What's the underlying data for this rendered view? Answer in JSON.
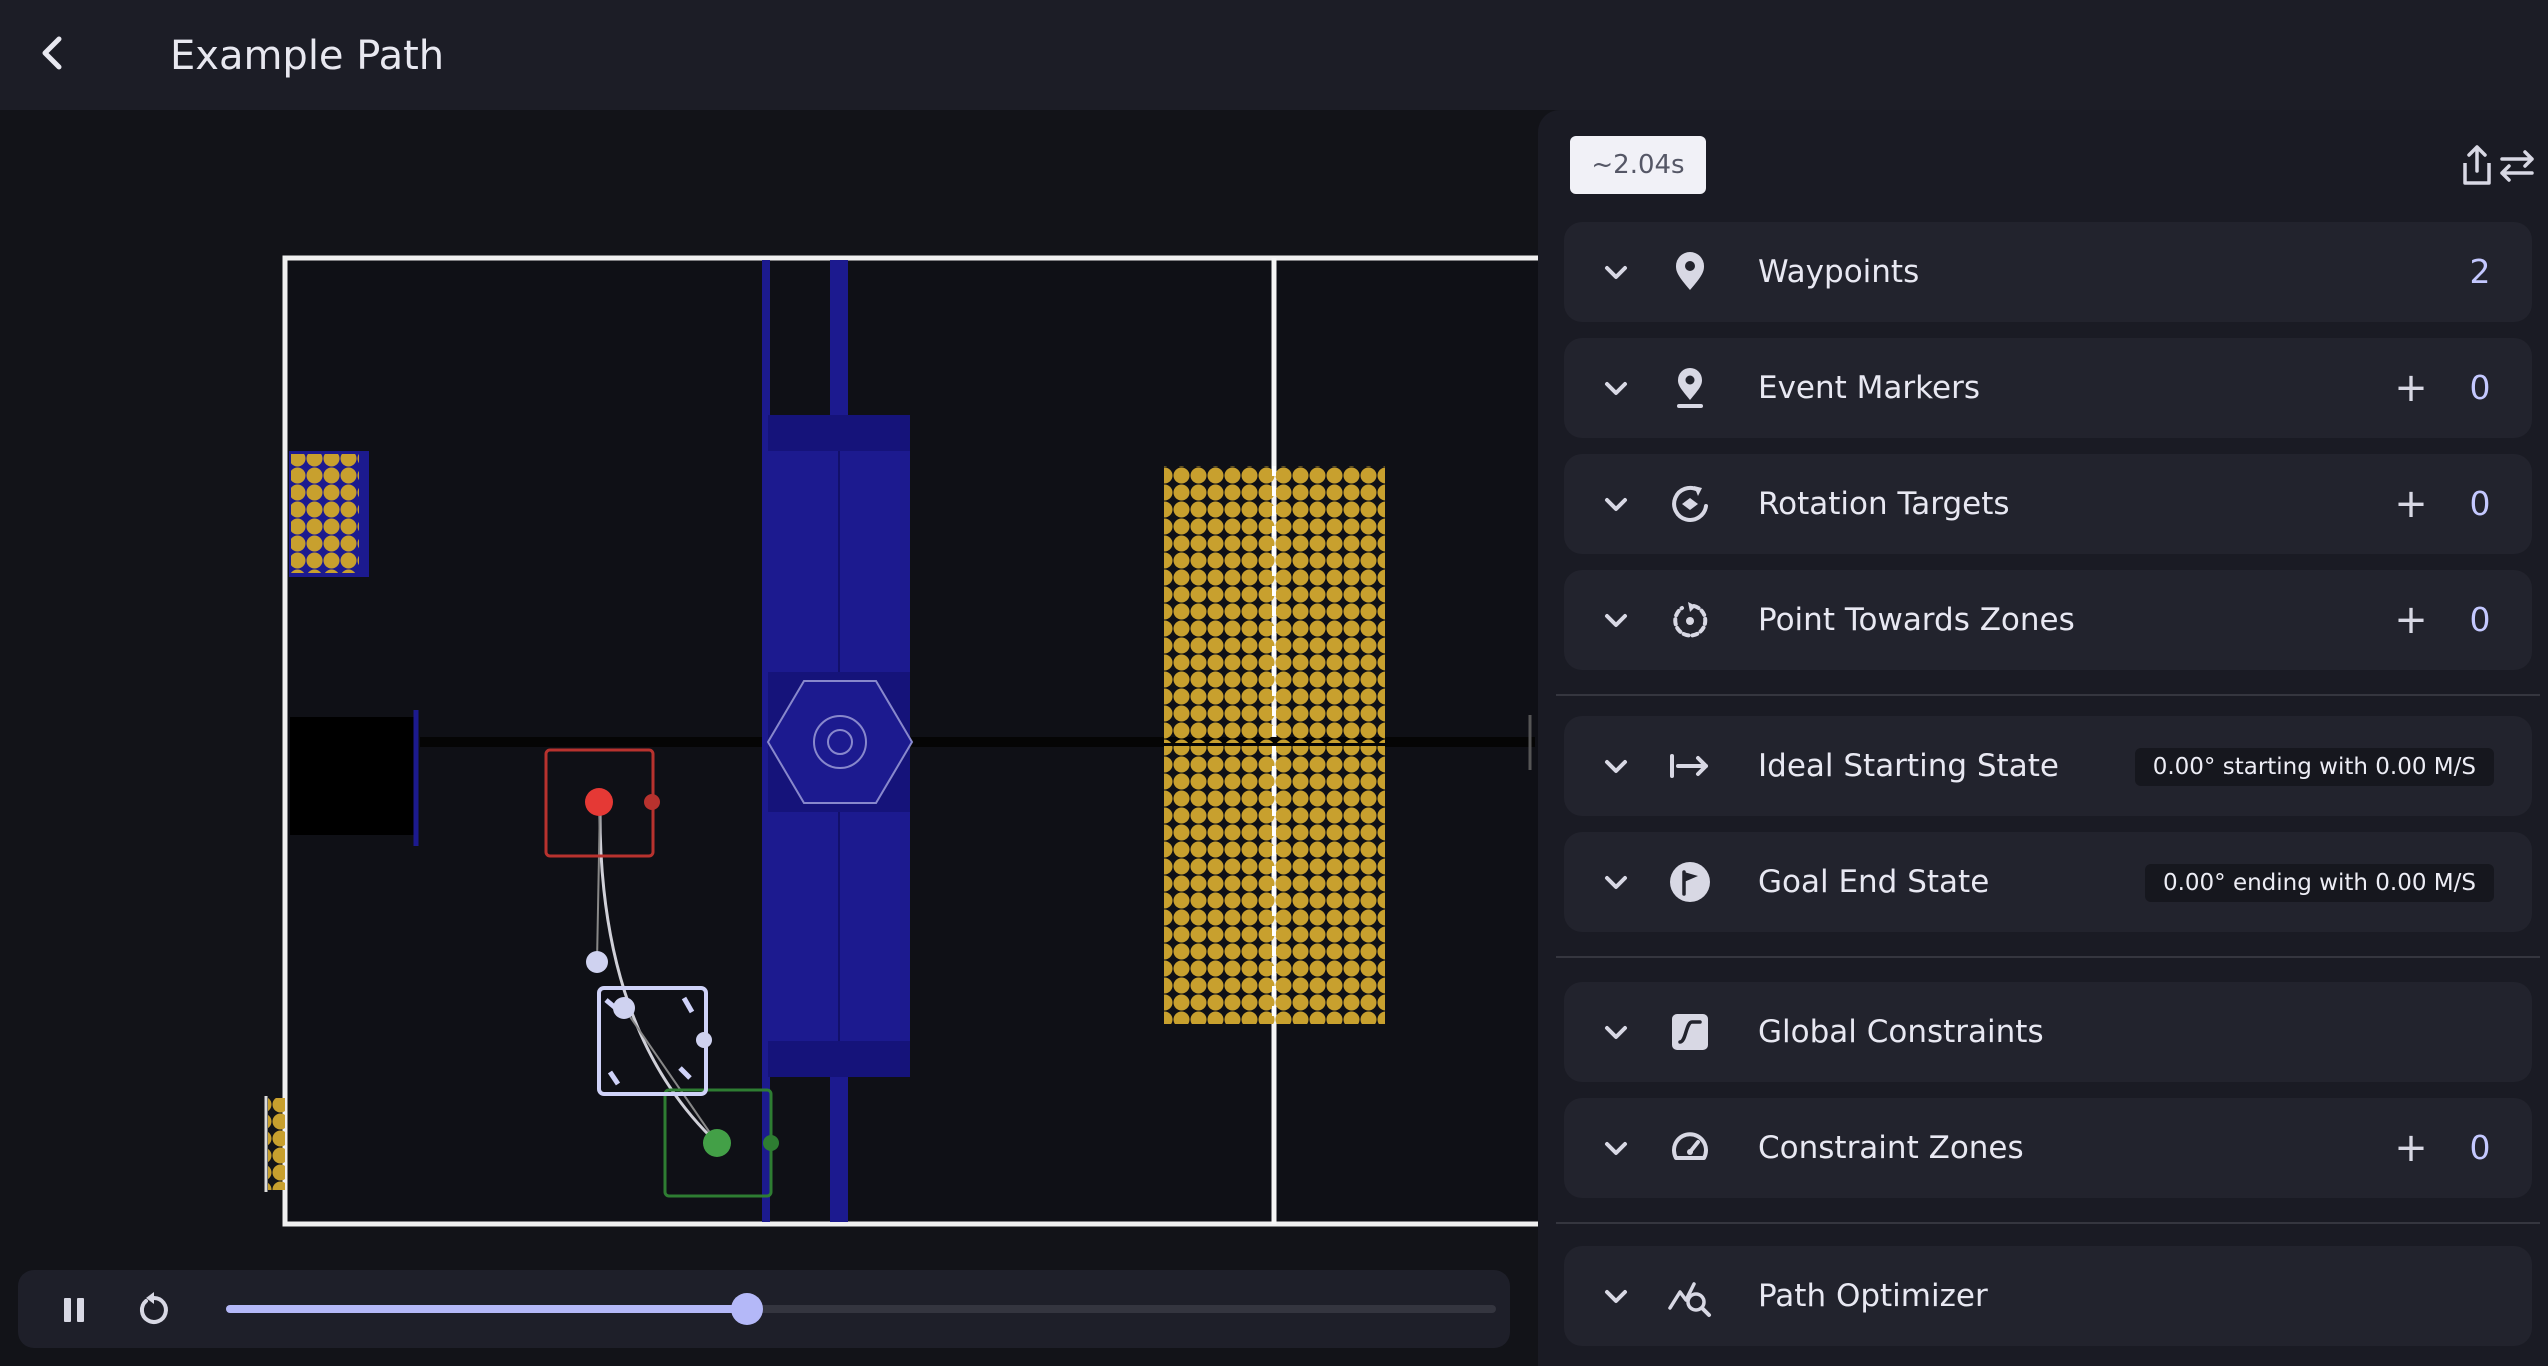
{
  "header": {
    "title": "Example Path"
  },
  "sidebar": {
    "time_estimate": "~2.04s",
    "sections": [
      {
        "label": "Waypoints",
        "count": "2",
        "icon": "location-pin-icon"
      },
      {
        "label": "Event Markers",
        "count": "0",
        "add": "+",
        "icon": "event-marker-icon"
      },
      {
        "label": "Rotation Targets",
        "count": "0",
        "add": "+",
        "icon": "rotation-target-icon"
      },
      {
        "label": "Point Towards Zones",
        "count": "0",
        "add": "+",
        "icon": "point-towards-icon"
      },
      {
        "label": "Ideal Starting State",
        "value": "0.00° starting with 0.00 M/S",
        "icon": "start-arrow-icon"
      },
      {
        "label": "Goal End State",
        "value": "0.00° ending with 0.00 M/S",
        "icon": "flag-icon"
      },
      {
        "label": "Global Constraints",
        "icon": "constraint-graph-icon"
      },
      {
        "label": "Constraint Zones",
        "count": "0",
        "add": "+",
        "icon": "speedometer-icon"
      },
      {
        "label": "Path Optimizer",
        "icon": "optimizer-icon"
      }
    ]
  },
  "playback": {
    "state": "playing",
    "progress": 0.41
  },
  "colors": {
    "accent": "#b4b8f8",
    "field_blue": "#1c1a8f",
    "fuel_yellow": "#c8a02e",
    "start_robot": "#e53935",
    "end_robot": "#43a047"
  }
}
